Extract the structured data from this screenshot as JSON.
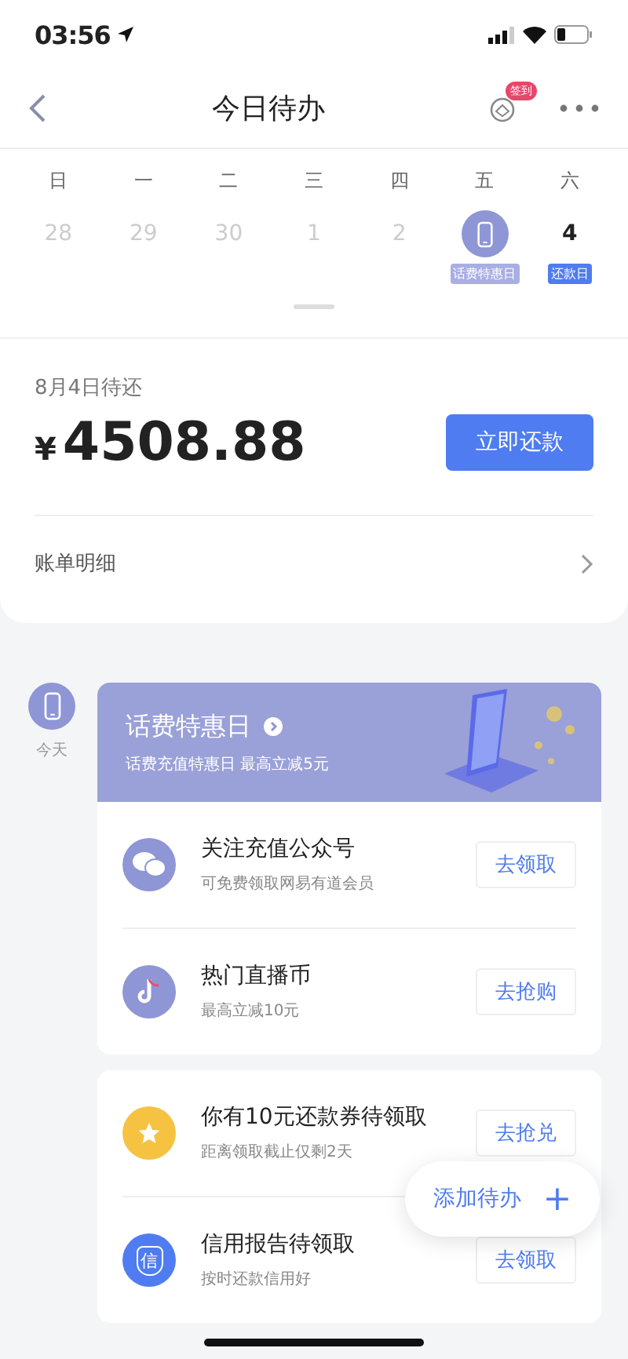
{
  "status_bar": {
    "time": "03:56"
  },
  "nav": {
    "title": "今日待办",
    "badge": "签到"
  },
  "calendar": {
    "weekdays": [
      "日",
      "一",
      "二",
      "三",
      "四",
      "五",
      "六"
    ],
    "days": [
      {
        "kind": "date",
        "label": "28",
        "dimmed": true
      },
      {
        "kind": "date",
        "label": "29",
        "dimmed": true
      },
      {
        "kind": "date",
        "label": "30",
        "dimmed": true
      },
      {
        "kind": "date",
        "label": "1",
        "dimmed": true
      },
      {
        "kind": "date",
        "label": "2",
        "dimmed": true
      },
      {
        "kind": "phone",
        "tag": "话费特惠日",
        "color": "#a9aee3"
      },
      {
        "kind": "date",
        "label": "4",
        "dimmed": false,
        "tag": "还款日",
        "color": "#4f7cf0"
      }
    ]
  },
  "bill": {
    "caption": "8月4日待还",
    "currency": "¥",
    "amount": "4508.88",
    "pay_button": "立即还款",
    "details_link": "账单明细"
  },
  "timeline": {
    "label": "今天"
  },
  "promo": {
    "title": "话费特惠日",
    "subtitle": "话费充值特惠日 最高立减5元"
  },
  "cards": [
    {
      "rows": [
        {
          "kind": "chat",
          "color": "#8e96d6",
          "title": "关注充值公众号",
          "subtitle": "可免费领取网易有道会员",
          "action": "去领取"
        },
        {
          "kind": "note",
          "color": "#8e96d6",
          "title": "热门直播币",
          "subtitle": "最高立减10元",
          "action": "去抢购"
        }
      ]
    },
    {
      "rows": [
        {
          "kind": "star",
          "color": "#f5c242",
          "title": "你有10元还款券待领取",
          "subtitle": "距离领取截止仅剩2天",
          "action": "去抢兑"
        },
        {
          "kind": "shield",
          "color": "#4f7cf0",
          "glyph": "信",
          "title": "信用报告待领取",
          "subtitle": "按时还款信用好",
          "action": "去领取"
        }
      ]
    }
  ],
  "fab": {
    "label": "添加待办",
    "icon": "+"
  }
}
